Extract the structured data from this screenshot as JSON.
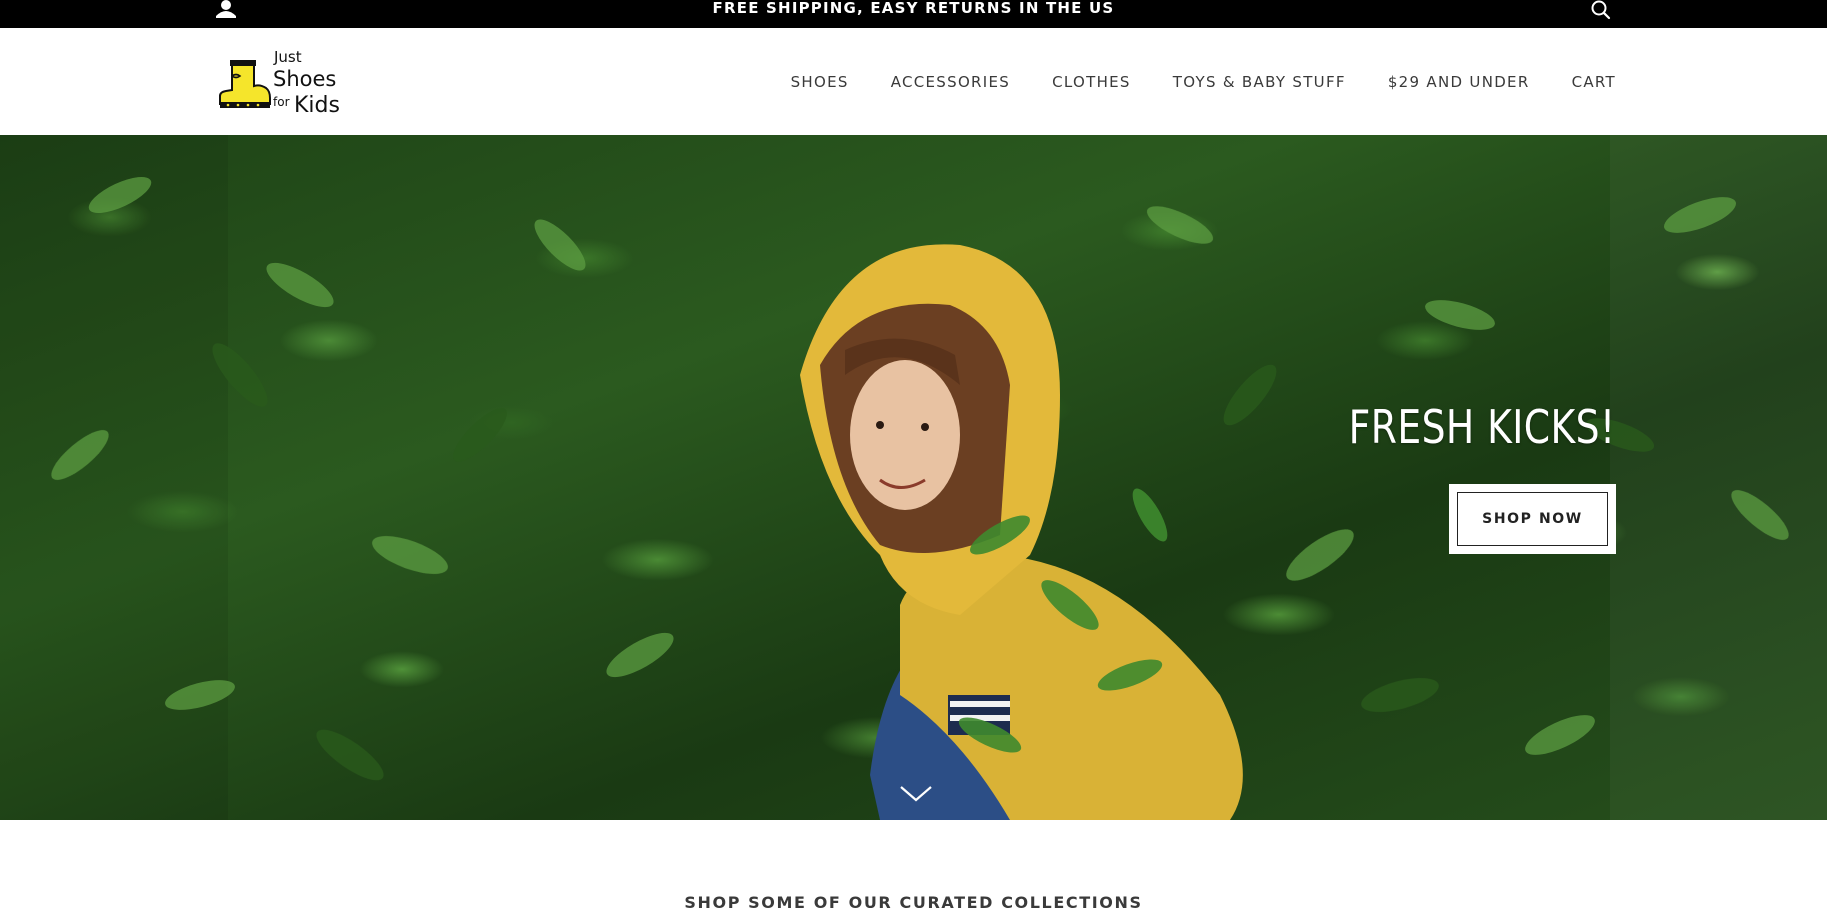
{
  "announcement": {
    "text": "FREE SHIPPING, EASY RETURNS IN THE US"
  },
  "icons": {
    "account": "user-icon",
    "search": "search-icon",
    "scroll": "chevron-down-icon"
  },
  "logo": {
    "line1": "Just",
    "line2": "Shoes",
    "line3": "for",
    "line4": "Kids",
    "boot_color": "#f5e52b"
  },
  "nav": {
    "items": [
      {
        "label": "SHOES"
      },
      {
        "label": "ACCESSORIES"
      },
      {
        "label": "CLOTHES"
      },
      {
        "label": "TOYS & BABY STUFF"
      },
      {
        "label": "$29 AND UNDER"
      },
      {
        "label": "CART"
      }
    ]
  },
  "hero": {
    "headline": "FRESH KICKS!",
    "button_label": "SHOP NOW",
    "raincoat_color": "#e3b93a"
  },
  "collections": {
    "heading": "SHOP SOME OF OUR CURATED COLLECTIONS"
  },
  "colors": {
    "topbar_bg": "#000000",
    "text_dark": "#3a3a3a",
    "foliage": "#2b5a1f"
  }
}
